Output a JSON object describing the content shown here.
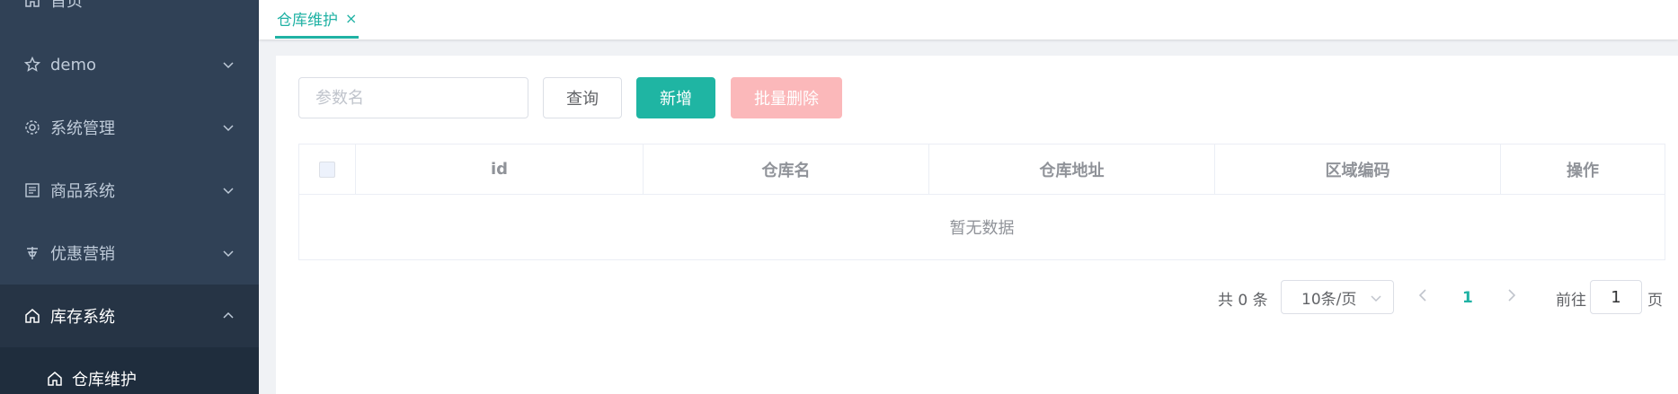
{
  "sidebar": {
    "items": [
      {
        "label": "首页",
        "icon": "home-icon"
      },
      {
        "label": "demo",
        "icon": "star-icon"
      },
      {
        "label": "系统管理",
        "icon": "gear-icon"
      },
      {
        "label": "商品系统",
        "icon": "product-icon"
      },
      {
        "label": "优惠营销",
        "icon": "coupon-icon"
      },
      {
        "label": "库存系统",
        "icon": "home-icon"
      }
    ],
    "submenu": {
      "label": "仓库维护",
      "icon": "home-icon"
    }
  },
  "tagbar": {
    "active_tag": "仓库维护",
    "close_glyph": "×"
  },
  "search": {
    "placeholder": "参数名"
  },
  "toolbar": {
    "query_label": "查询",
    "add_label": "新增",
    "batch_delete_label": "批量删除"
  },
  "table": {
    "columns": [
      "id",
      "仓库名",
      "仓库地址",
      "区域编码",
      "操作"
    ],
    "empty_text": "暂无数据"
  },
  "pagination": {
    "total_text": "共 0 条",
    "page_size": "10条/页",
    "current_page": "1",
    "goto_label": "前往",
    "goto_value": "1",
    "page_suffix": "页"
  },
  "colors": {
    "sidebar_bg": "#304156",
    "accent": "#20b2a4",
    "danger_disabled": "#fbb8ba"
  }
}
